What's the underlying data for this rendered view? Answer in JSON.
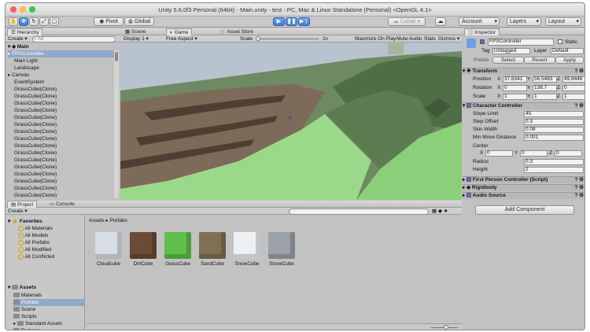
{
  "window": {
    "title": "Unity 5.6.0f3 Personal (64bit) - Main.unity - test - PC, Mac & Linux Standalone (Personal) <OpenGL 4.1>"
  },
  "toolbar": {
    "pivot": "Pivot",
    "global": "Global",
    "collab": "Collab",
    "account": "Account",
    "layers": "Layers",
    "layout": "Layout"
  },
  "hierarchy": {
    "tab": "Hierarchy",
    "create": "Create",
    "search_placeholder": "All",
    "scene": "Main",
    "items": [
      "FPSController",
      "Main Light",
      "Landscape",
      "Canvas",
      "EventSystem",
      "GrassCube(Clone)",
      "GrassCube(Clone)",
      "GrassCube(Clone)",
      "GrassCube(Clone)",
      "GrassCube(Clone)",
      "GrassCube(Clone)",
      "GrassCube(Clone)",
      "GrassCube(Clone)",
      "GrassCube(Clone)",
      "GrassCube(Clone)",
      "GrassCube(Clone)",
      "GrassCube(Clone)",
      "GrassCube(Clone)",
      "GrassCube(Clone)",
      "GrassCube(Clone)",
      "GrassCube(Clone)"
    ]
  },
  "game": {
    "tabs": [
      "Scene",
      "Game",
      "Asset Store"
    ],
    "display": "Display 1",
    "aspect": "Free Aspect",
    "scale_label": "Scale",
    "scale_value": "2x",
    "maximize": "Maximize On Play",
    "mute": "Mute Audio",
    "stats": "Stats",
    "gizmos": "Gizmos"
  },
  "project": {
    "tabs": [
      "Project",
      "Console"
    ],
    "create": "Create",
    "breadcrumb_root": "Assets",
    "breadcrumb_current": "Prefabs",
    "favorites_title": "Favorites",
    "favorites": [
      "All Materials",
      "All Models",
      "All Prefabs",
      "All Modified",
      "All Conflicted"
    ],
    "assets_title": "Assets",
    "folders": [
      "Materials",
      "Prefabs",
      "Scene",
      "Scripts",
      "Standard Assets",
      "Textures"
    ],
    "items": [
      "Cloudcube",
      "DirtCube",
      "GrassCube",
      "SandCube",
      "SnowCube",
      "StoneCube"
    ]
  },
  "inspector": {
    "tab": "Inspector",
    "object_name": "FPSController",
    "static_label": "Static",
    "tag_label": "Tag",
    "tag_value": "Untagged",
    "layer_label": "Layer",
    "layer_value": "Default",
    "prefab_label": "Prefab",
    "select": "Select",
    "revert": "Revert",
    "apply": "Apply",
    "transform": {
      "title": "Transform",
      "position_label": "Position",
      "rotation_label": "Rotation",
      "scale_label": "Scale",
      "position": [
        "37.6341",
        "56.5483",
        "49.8446"
      ],
      "rotation": [
        "0",
        "138.7",
        "0"
      ],
      "scale": [
        "1",
        "1",
        "1"
      ]
    },
    "character_controller": {
      "title": "Character Controller",
      "slope_limit_label": "Slope Limit",
      "slope_limit": "45",
      "step_offset_label": "Step Offset",
      "step_offset": "0.3",
      "skin_width_label": "Skin Width",
      "skin_width": "0.08",
      "min_move_label": "Min Move Distance",
      "min_move": "0.001",
      "center_label": "Center",
      "center": [
        "0",
        "0",
        "0"
      ],
      "radius_label": "Radius",
      "radius": "0.3",
      "height_label": "Height",
      "height": "2"
    },
    "components": [
      "First Person Controller (Script)",
      "Rigidbody",
      "Audio Source"
    ],
    "add_component": "Add Component"
  }
}
